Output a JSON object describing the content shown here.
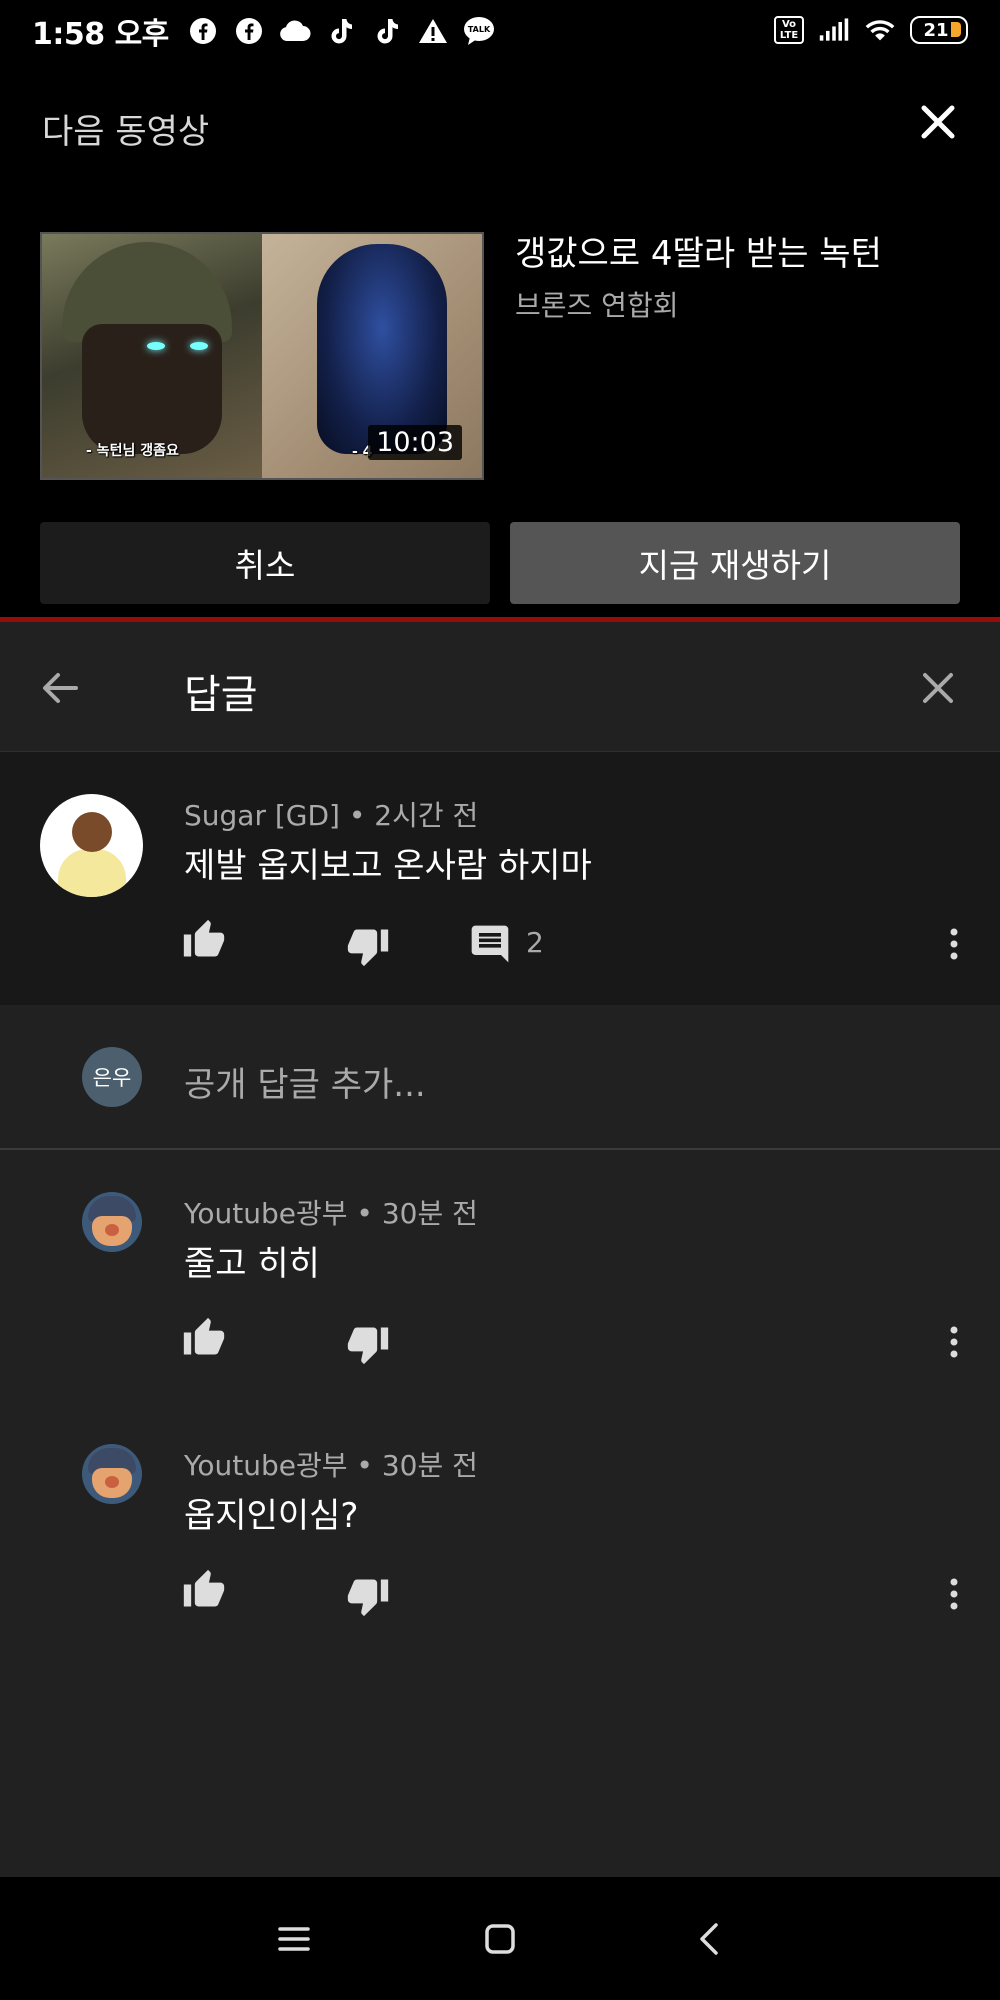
{
  "status_bar": {
    "time": "1:58 오후",
    "left_icons": [
      "facebook-icon",
      "facebook-icon",
      "cloud-icon",
      "tiktok-icon",
      "tiktok-icon",
      "warning-icon",
      "talk-icon"
    ],
    "talk_label": "TALK",
    "volte_label": "Vo LTE",
    "battery_level": "21"
  },
  "up_next": {
    "heading": "다음 동영상",
    "video_title": "갱값으로 4딸라 받는 녹턴",
    "channel": "브론즈 연합회",
    "duration": "10:03",
    "thumb_subtitle_left": "- 녹턴님 갱좀요",
    "thumb_subtitle_right": "- 4",
    "cancel_label": "취소",
    "play_now_label": "지금 재생하기"
  },
  "replies_panel": {
    "title": "답글",
    "parent_comment": {
      "meta": "Sugar [GD] • 2시간 전",
      "text": "제발 옵지보고 온사람 하지마",
      "reply_count": "2"
    },
    "add_reply": {
      "avatar_text": "은우",
      "placeholder": "공개 답글 추가..."
    },
    "replies": [
      {
        "meta": "Youtube광부 • 30분 전",
        "text": "줄고 히히"
      },
      {
        "meta": "Youtube광부 • 30분 전",
        "text": "옵지인이심?"
      }
    ]
  },
  "colors": {
    "background": "#212121",
    "parent_bg": "#181818",
    "accent_red": "#9a0b0b",
    "secondary_text": "#aaaaaa"
  }
}
